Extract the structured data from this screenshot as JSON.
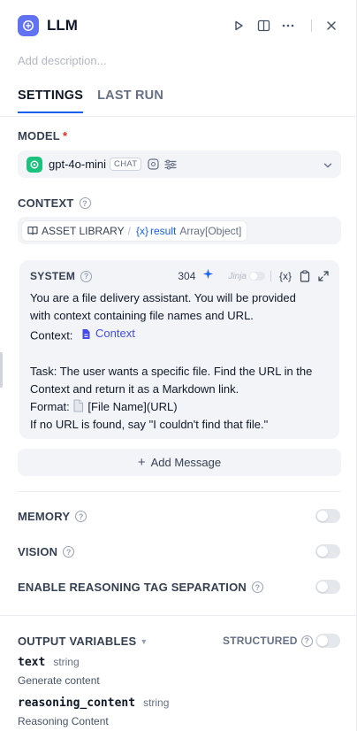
{
  "header": {
    "title": "LLM",
    "description_placeholder": "Add description..."
  },
  "tabs": [
    {
      "label": "SETTINGS",
      "active": true
    },
    {
      "label": "LAST RUN",
      "active": false
    }
  ],
  "model": {
    "label": "MODEL",
    "required_mark": "*",
    "name": "gpt-4o-mini",
    "mode_badge": "CHAT"
  },
  "context": {
    "label": "CONTEXT",
    "source": "ASSET LIBRARY",
    "separator": "/",
    "variable_prefix": "{x}",
    "variable": "result",
    "type": "Array[Object]"
  },
  "system": {
    "label": "SYSTEM",
    "token_count": "304",
    "jinja_label": "Jinja",
    "variable_button": "{x}",
    "lines": {
      "l1": "You are a file delivery assistant. You will be provided",
      "l2": "with context containing file names and URL.",
      "l3_prefix": "Context:",
      "l3_context": "Context",
      "l5": "Task: The user wants a specific file. Find the URL in the",
      "l6": "Context and return it as a Markdown link.",
      "l7_prefix": "Format:",
      "l7_rest": "[File Name](URL)",
      "l8": "If no URL is found, say \"I couldn't find that file.\""
    }
  },
  "add_message_label": "Add Message",
  "memory": {
    "label": "MEMORY",
    "enabled": false
  },
  "vision": {
    "label": "VISION",
    "enabled": false
  },
  "reasoning": {
    "label": "ENABLE REASONING TAG SEPARATION",
    "enabled": false
  },
  "output": {
    "label": "OUTPUT VARIABLES",
    "structured_label": "STRUCTURED",
    "structured_enabled": false,
    "variables": [
      {
        "name": "text",
        "type": "string",
        "description": "Generate content"
      },
      {
        "name": "reasoning_content",
        "type": "string",
        "description": "Reasoning Content"
      }
    ]
  },
  "colors": {
    "accent": "#155eef",
    "node_icon": "#6172f3",
    "gpt_icon": "#19c37d",
    "required": "#d92d20",
    "context_pill": "#444ce7"
  },
  "icons": [
    "llm-node-icon",
    "play-icon",
    "split-view-icon",
    "more-icon",
    "close-icon",
    "help-icon",
    "openai-icon",
    "vision-chip-icon",
    "sliders-icon",
    "chevron-down-icon",
    "book-icon",
    "variable-icon",
    "sparkle-icon",
    "clipboard-icon",
    "expand-icon",
    "context-icon",
    "file-icon",
    "plus-icon",
    "caret-down-icon"
  ]
}
